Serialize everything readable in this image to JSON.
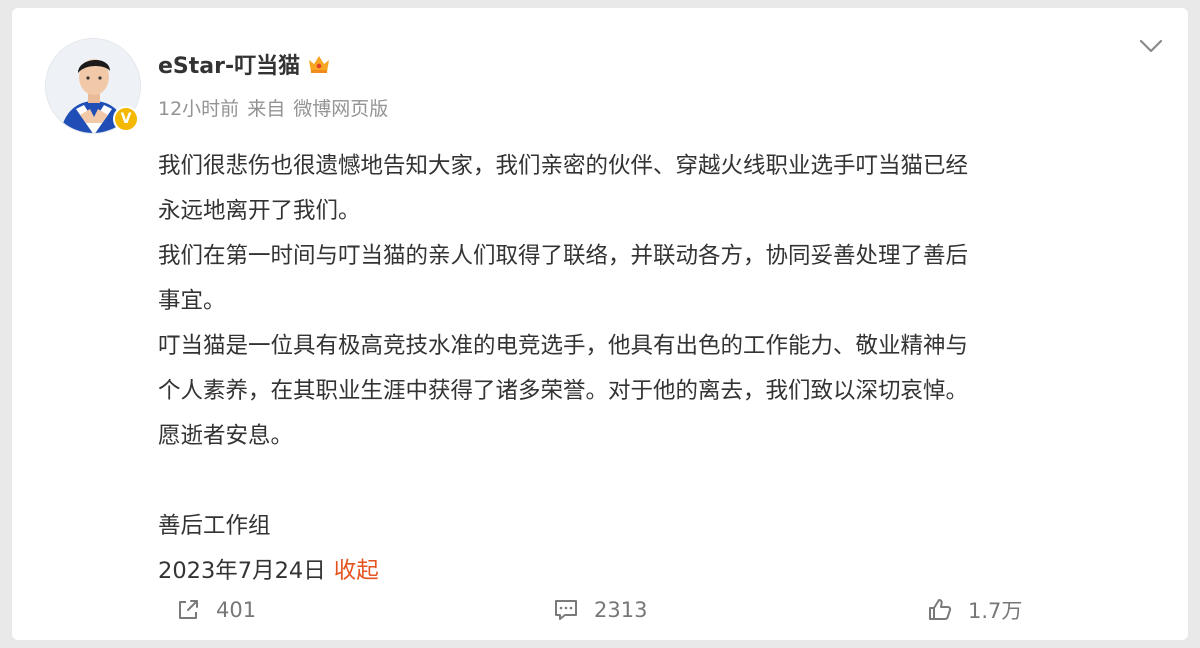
{
  "post": {
    "author": "eStar-叮当猫",
    "time": "12小时前",
    "source_prefix": "来自",
    "source": "微博网页版",
    "content_lines": [
      "我们很悲伤也很遗憾地告知大家，我们亲密的伙伴、穿越火线职业选手叮当猫已经",
      "永远地离开了我们。",
      "我们在第一时间与叮当猫的亲人们取得了联络，并联动各方，协同妥善处理了善后",
      "事宜。",
      "叮当猫是一位具有极高竞技水准的电竞选手，他具有出色的工作能力、敬业精神与",
      "个人素养，在其职业生涯中获得了诸多荣誉。对于他的离去，我们致以深切哀悼。",
      "愿逝者安息。"
    ],
    "signature": "善后工作组",
    "date": "2023年7月24日",
    "collapse_label": "收起"
  },
  "actions": {
    "share_count": "401",
    "comment_count": "2313",
    "like_count": "1.7万"
  },
  "icons": [
    "avatar",
    "verified-v-icon",
    "crown-icon",
    "chevron-down-icon",
    "share-icon",
    "comment-icon",
    "like-icon"
  ],
  "colors": {
    "collapse_link": "#e5531f",
    "verified_badge": "#f5b800",
    "meta_text": "#939393"
  }
}
